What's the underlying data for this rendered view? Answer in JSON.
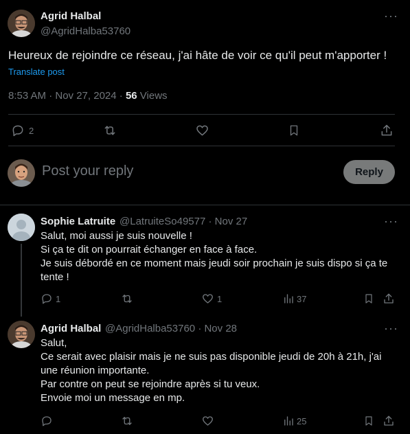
{
  "post": {
    "author_name": "Agrid Halbal",
    "author_handle": "@AgridHalba53760",
    "text": "Heureux de rejoindre ce réseau, j'ai hâte de voir ce qu'il peut m'apporter !",
    "translate": "Translate post",
    "time": "8:53 AM · Nov 27, 2024 · ",
    "views_count": "56",
    "views_label": "Views",
    "replies_count": "2",
    "more": "···"
  },
  "composer": {
    "placeholder": "Post your reply",
    "reply_button": "Reply"
  },
  "replies": [
    {
      "name": "Sophie Latruite",
      "handle": "@LatruiteSo49577 · Nov 27",
      "lines": [
        "Salut, moi aussi je suis nouvelle !",
        "Si ça te dit on pourrait échanger en face à face.",
        "Je suis débordé en ce moment mais jeudi soir prochain je suis dispo si ça te",
        "tente !"
      ],
      "reply_count": "1",
      "like_count": "1",
      "views": "37"
    },
    {
      "name": "Agrid Halbal",
      "handle": "@AgridHalba53760 · Nov 28",
      "lines": [
        "Salut,",
        "Ce serait avec plaisir mais je ne suis pas disponible jeudi de 20h à 21h, j'ai",
        "une réunion importante.",
        "Par contre on peut se rejoindre après si tu veux.",
        "Envoie moi un message en mp."
      ],
      "views": "25"
    }
  ]
}
